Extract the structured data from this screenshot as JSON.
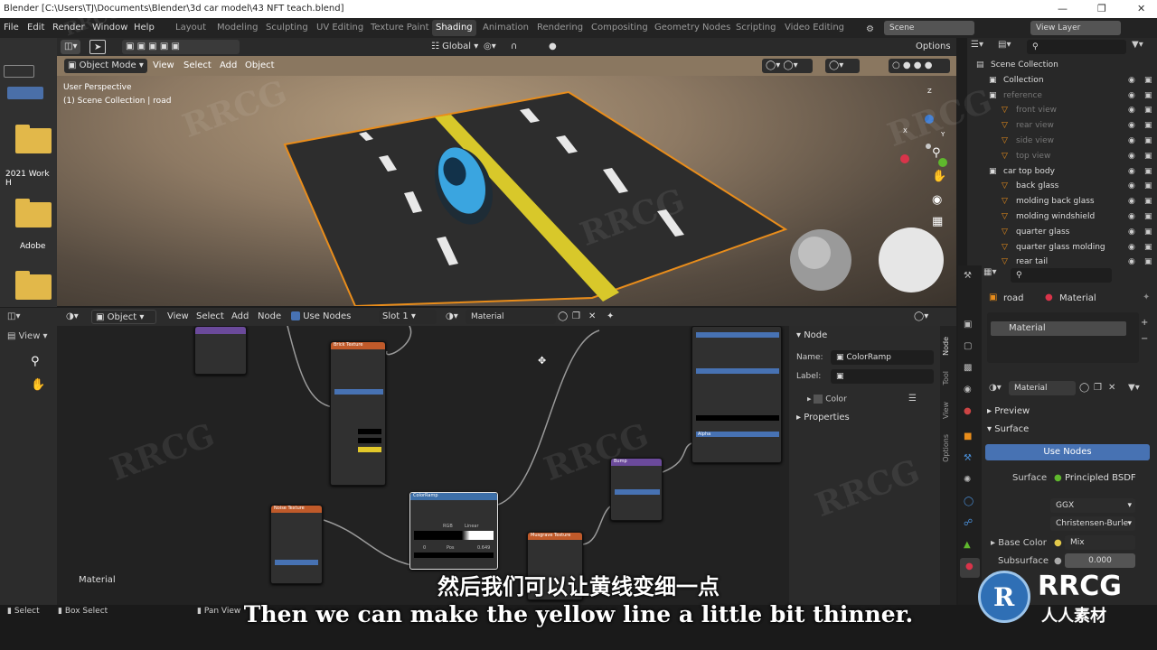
{
  "window": {
    "title": "Blender [C:\\Users\\TJ\\Documents\\Blender\\3d car model\\43 NFT teach.blend]"
  },
  "menu": [
    "File",
    "Edit",
    "Render",
    "Window",
    "Help"
  ],
  "workspaces": [
    "Layout",
    "Modeling",
    "Sculpting",
    "UV Editing",
    "Texture Paint",
    "Shading",
    "Animation",
    "Rendering",
    "Compositing",
    "Geometry Nodes",
    "Scripting",
    "Video Editing"
  ],
  "active_workspace": "Shading",
  "scene": "Scene",
  "view_layer": "View Layer",
  "desktop": {
    "label1": "2021 Work H",
    "label2": "Adobe"
  },
  "viewport": {
    "header": {
      "view": "View",
      "transform": "Global",
      "options": "Options"
    },
    "mode": "Object Mode",
    "menus": [
      "View",
      "Select",
      "Add",
      "Object"
    ],
    "info_line1": "User Perspective",
    "info_line2": "(1) Scene Collection | road",
    "gizmo": {
      "x": "X",
      "y": "Y",
      "z": "Z"
    }
  },
  "outliner": {
    "rows": [
      {
        "label": "Scene Collection",
        "indent": 0
      },
      {
        "label": "Collection",
        "indent": 1
      },
      {
        "label": "reference",
        "indent": 1,
        "dim": true
      },
      {
        "label": "front view",
        "indent": 2,
        "dim": true
      },
      {
        "label": "rear view",
        "indent": 2,
        "dim": true
      },
      {
        "label": "side view",
        "indent": 2,
        "dim": true
      },
      {
        "label": "top view",
        "indent": 2,
        "dim": true
      },
      {
        "label": "car top body",
        "indent": 1
      },
      {
        "label": "back glass",
        "indent": 2
      },
      {
        "label": "molding back glass",
        "indent": 2
      },
      {
        "label": "molding windshield",
        "indent": 2
      },
      {
        "label": "quarter glass",
        "indent": 2
      },
      {
        "label": "quarter glass molding",
        "indent": 2
      },
      {
        "label": "rear tail",
        "indent": 2
      }
    ]
  },
  "node_editor": {
    "editor_type": "Object",
    "menus": [
      "View",
      "Select",
      "Add",
      "Node"
    ],
    "use_nodes": "Use Nodes",
    "slot": "Slot 1",
    "material": "Material",
    "left_view": "View",
    "corner_label": "Material",
    "nodes": {
      "brick": "Brick Texture",
      "noise": "Noise Texture",
      "colorramp": "ColorRamp",
      "musgrave": "Musgrave Texture",
      "bump": "Bump",
      "bsdf_last": "Alpha",
      "ramp_interp": "Linear",
      "ramp_mode": "RGB",
      "ramp_pos_label": "Pos",
      "ramp_pos": "0.649",
      "ramp_index": "0"
    }
  },
  "n_panel": {
    "section": "Node",
    "name_label": "Name:",
    "name_value": "ColorRamp",
    "label_label": "Label:",
    "color": "Color",
    "properties": "Properties",
    "tabs": [
      "Node",
      "Tool",
      "View",
      "Options"
    ]
  },
  "properties": {
    "object": "road",
    "material_tab": "Material",
    "slot_item": "Material",
    "material_name": "Material",
    "preview": "Preview",
    "surface_header": "Surface",
    "use_nodes": "Use Nodes",
    "surface_label": "Surface",
    "surface_value": "Principled BSDF",
    "distribution": "GGX",
    "subsurface_method": "Christensen-Burle",
    "base_color_label": "Base Color",
    "base_color_value": "Mix",
    "subsurface_label": "Subsurface",
    "subsurface_value": "0.000"
  },
  "status": {
    "select": "Select",
    "box_select": "Box Select",
    "pan": "Pan View"
  },
  "subtitle": {
    "cn": "然后我们可以让黄线变细一点",
    "en": "Then we can make the yellow line a little bit thinner."
  },
  "watermark": {
    "text": "RRCG",
    "brand_cn": "人人素材"
  },
  "colors": {
    "accent": "#4772b3",
    "road_outline": "#e98d1b",
    "yellow_line": "#d8c82a",
    "car": "#3aa5e0"
  }
}
